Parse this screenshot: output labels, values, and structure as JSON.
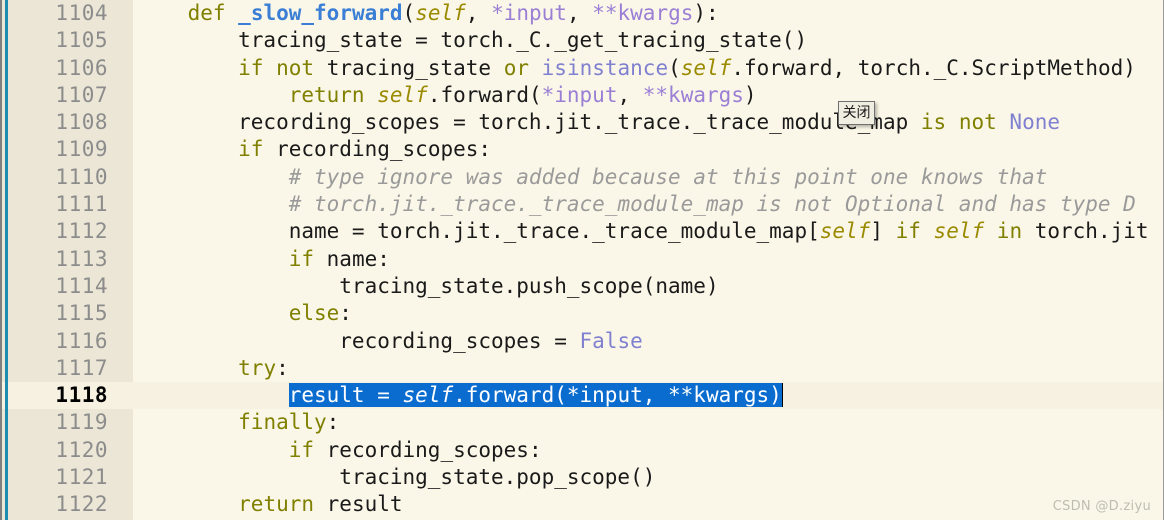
{
  "editor": {
    "name": "code-editor",
    "background": "#fbf7e8",
    "gutter_background": "#ebe6d5",
    "current_line": 1118,
    "selection_color": "#0a6ccf",
    "marker_color": "#1c8cb0"
  },
  "tooltip": {
    "label": "关闭"
  },
  "watermark": {
    "text": "CSDN @D.ziyu"
  },
  "lines": [
    {
      "number": "1104"
    },
    {
      "number": "1105"
    },
    {
      "number": "1106"
    },
    {
      "number": "1107"
    },
    {
      "number": "1108"
    },
    {
      "number": "1109"
    },
    {
      "number": "1110"
    },
    {
      "number": "1111"
    },
    {
      "number": "1112"
    },
    {
      "number": "1113"
    },
    {
      "number": "1114"
    },
    {
      "number": "1115"
    },
    {
      "number": "1116"
    },
    {
      "number": "1117"
    },
    {
      "number": "1118"
    },
    {
      "number": "1119"
    },
    {
      "number": "1120"
    },
    {
      "number": "1121"
    },
    {
      "number": "1122"
    }
  ],
  "code": {
    "l1104": {
      "indent": "    ",
      "kw_def": "def",
      "name": "_slow_forward",
      "p1": "(",
      "self": "self",
      "p2": ", ",
      "input": "*input",
      "p3": ", ",
      "kwargs": "**kwargs",
      "p4": "):"
    },
    "l1105": {
      "text": "        tracing_state = torch._C._get_tracing_state()"
    },
    "l1106": {
      "pre": "        ",
      "kw_if": "if",
      "sp1": " ",
      "kw_not": "not",
      "sp2": " tracing_state ",
      "kw_or": "or",
      "sp3": " ",
      "builtin": "isinstance",
      "p1": "(",
      "self": "self",
      "p2": ".forward, torch._C.ScriptMethod)"
    },
    "l1107": {
      "pre": "            ",
      "kw": "return",
      "sp": " ",
      "self": "self",
      "mid": ".forward(",
      "input": "*input",
      "sep": ", ",
      "kwargs": "**kwargs",
      "end": ")"
    },
    "l1108": {
      "pre": "        recording_scopes = torch.jit._trace._trace_module_map ",
      "kw_is": "is",
      "sp1": " ",
      "kw_not": "not",
      "sp2": " ",
      "const": "None"
    },
    "l1109": {
      "pre": "        ",
      "kw_if": "if",
      "rest": " recording_scopes:"
    },
    "l1110": {
      "pre": "            ",
      "comment": "# type ignore was added because at this point one knows that"
    },
    "l1111": {
      "pre": "            ",
      "comment": "# torch.jit._trace._trace_module_map is not Optional and has type D"
    },
    "l1112": {
      "pre": "            name = torch.jit._trace._trace_module_map[",
      "self1": "self",
      "mid1": "] ",
      "kw_if": "if",
      "mid2": " ",
      "self2": "self",
      "mid3": " ",
      "kw_in": "in",
      "end": " torch.jit"
    },
    "l1113": {
      "pre": "            ",
      "kw_if": "if",
      "rest": " name:"
    },
    "l1114": {
      "text": "                tracing_state.push_scope(name)"
    },
    "l1115": {
      "pre": "            ",
      "kw_else": "else",
      "rest": ":"
    },
    "l1116": {
      "pre": "                recording_scopes = ",
      "const": "False"
    },
    "l1117": {
      "pre": "        ",
      "kw_try": "try",
      "rest": ":"
    },
    "l1118": {
      "pre": "            ",
      "sel_a": "result = ",
      "sel_self": "self",
      "sel_b": ".forward(*input, **kwargs)"
    },
    "l1119": {
      "pre": "        ",
      "kw_finally": "finally",
      "rest": ":"
    },
    "l1120": {
      "pre": "            ",
      "kw_if": "if",
      "rest": " recording_scopes:"
    },
    "l1121": {
      "text": "                tracing_state.pop_scope()"
    },
    "l1122": {
      "pre": "        ",
      "kw_return": "return",
      "rest": " result"
    }
  }
}
